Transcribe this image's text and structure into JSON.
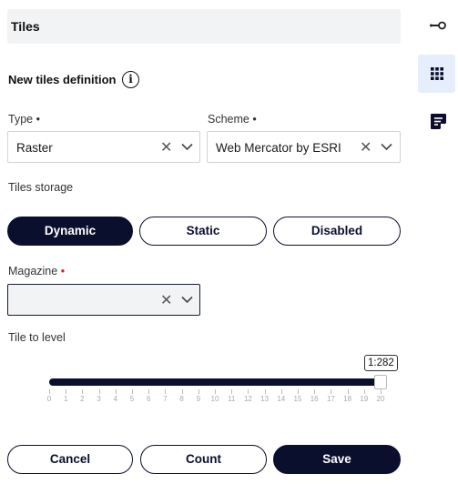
{
  "header": {
    "title": "Tiles"
  },
  "definition": {
    "title": "New tiles definition",
    "info_icon": "info-icon",
    "info_glyph": "i"
  },
  "type_field": {
    "label": "Type",
    "required_mark": "•",
    "value": "Raster"
  },
  "scheme_field": {
    "label": "Scheme",
    "required_mark": "•",
    "value": "Web Mercator by ESRI"
  },
  "storage": {
    "label": "Tiles storage",
    "options": [
      "Dynamic",
      "Static",
      "Disabled"
    ],
    "selected": "Dynamic"
  },
  "magazine_field": {
    "label": "Magazine",
    "required_mark": "•",
    "value": ""
  },
  "tile_level": {
    "label": "Tile to level",
    "value": 20,
    "min": 0,
    "max": 20,
    "tooltip": "1:282",
    "tick_labels": [
      "0",
      "1",
      "2",
      "3",
      "4",
      "5",
      "6",
      "7",
      "8",
      "9",
      "10",
      "11",
      "12",
      "13",
      "14",
      "15",
      "16",
      "17",
      "18",
      "19",
      "20"
    ]
  },
  "footer": {
    "cancel_label": "Cancel",
    "count_label": "Count",
    "save_label": "Save"
  },
  "right_bar": {
    "items": [
      {
        "icon": "connection-icon",
        "active": false
      },
      {
        "icon": "grid-icon",
        "active": true
      },
      {
        "icon": "notes-edit-icon",
        "active": false
      }
    ]
  },
  "colors": {
    "primary": "#0b0f2e",
    "required": "#c62828",
    "active_tab_bg": "#e6eefb",
    "header_bg": "#f2f3f5"
  }
}
